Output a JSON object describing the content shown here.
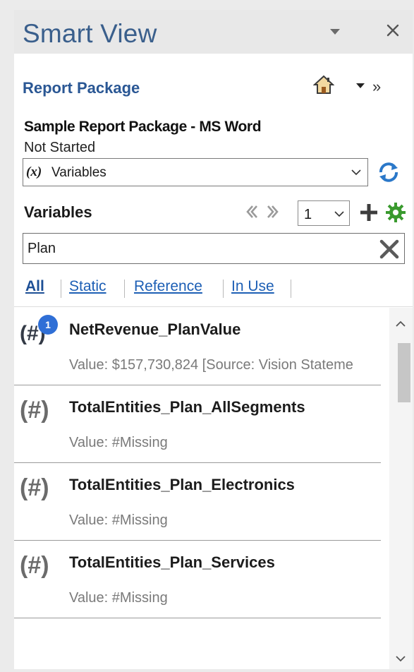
{
  "pane": {
    "title": "Smart View"
  },
  "package": {
    "nav_label": "Report Package",
    "name": "Sample Report Package - MS Word",
    "status": "Not Started",
    "forward_glyph": "»"
  },
  "variables_select": {
    "prefix": "(x)",
    "selected": "Variables"
  },
  "variables": {
    "heading": "Variables",
    "page": "1"
  },
  "search": {
    "value": "Plan"
  },
  "filters": [
    "All",
    "Static",
    "Reference",
    "In Use"
  ],
  "items": [
    {
      "badge": "1",
      "icon": "(#)",
      "name": "NetRevenue_PlanValue",
      "value": "Value:  $157,730,824  [Source: Vision Stateme"
    },
    {
      "icon": "(#)",
      "name": "TotalEntities_Plan_AllSegments",
      "value": "Value: #Missing"
    },
    {
      "icon": "(#)",
      "name": "TotalEntities_Plan_Electronics",
      "value": "Value: #Missing"
    },
    {
      "icon": "(#)",
      "name": "TotalEntities_Plan_Services",
      "value": "Value: #Missing"
    }
  ],
  "colors": {
    "title": "#3a5f8c",
    "link": "#1d5fb5",
    "badge": "#2f6fd6",
    "add": "#3d3d3d",
    "settings": "#3a9a2e"
  },
  "icons": {
    "title_menu": "triangle-down-icon",
    "close": "close-icon",
    "home": "home-icon",
    "dropdown": "caret-down-icon",
    "forward": "double-chevron-right-icon",
    "refresh": "refresh-icon",
    "prev": "chevron-left-double-icon",
    "next": "chevron-right-double-icon",
    "add": "plus-icon",
    "settings": "gear-icon",
    "clear": "clear-x-icon",
    "scroll_up": "scroll-up-icon",
    "scroll_down": "scroll-down-icon"
  }
}
